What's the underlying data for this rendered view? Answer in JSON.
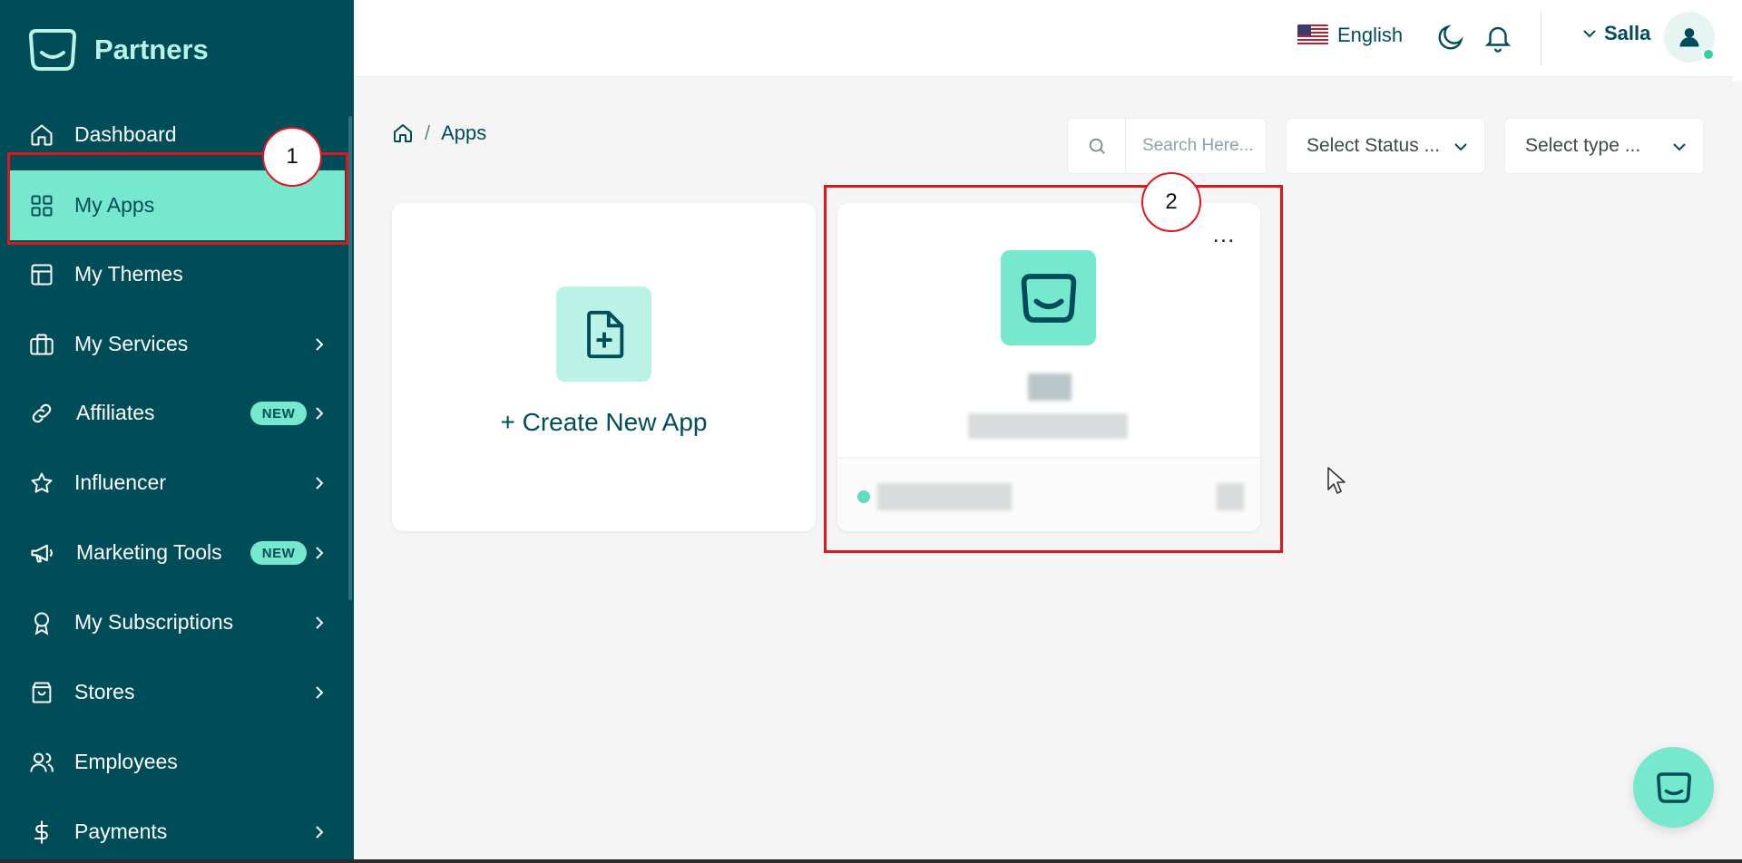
{
  "brand": {
    "name": "Partners"
  },
  "sidebar": {
    "items": [
      {
        "label": "Dashboard",
        "icon": "home-icon"
      },
      {
        "label": "My Apps",
        "icon": "grid-icon",
        "active": true
      },
      {
        "label": "My Themes",
        "icon": "layout-icon"
      },
      {
        "label": "My Services",
        "icon": "briefcase-icon"
      },
      {
        "label": "Affiliates",
        "icon": "link-icon",
        "badge": "NEW"
      },
      {
        "label": "Influencer",
        "icon": "star-icon"
      },
      {
        "label": "Marketing Tools",
        "icon": "megaphone-icon",
        "badge": "NEW"
      },
      {
        "label": "My Subscriptions",
        "icon": "award-icon"
      },
      {
        "label": "Stores",
        "icon": "shopping-bag-icon"
      },
      {
        "label": "Employees",
        "icon": "users-icon"
      },
      {
        "label": "Payments",
        "icon": "dollar-icon"
      }
    ]
  },
  "header": {
    "language": "English",
    "user_name": "Salla"
  },
  "breadcrumb": {
    "current": "Apps"
  },
  "filters": {
    "search_placeholder": "Search Here...",
    "status_select": "Select Status ...",
    "type_select": "Select type ..."
  },
  "create_card": {
    "label": "+ Create New App"
  },
  "app_card": {
    "more_label": "..."
  },
  "annotations": {
    "first": "1",
    "second": "2"
  },
  "colors": {
    "sidebar_bg": "#004d5a",
    "accent": "#76e8cd",
    "accent_light": "#baf3e6",
    "annotation_red": "#e0161c"
  }
}
